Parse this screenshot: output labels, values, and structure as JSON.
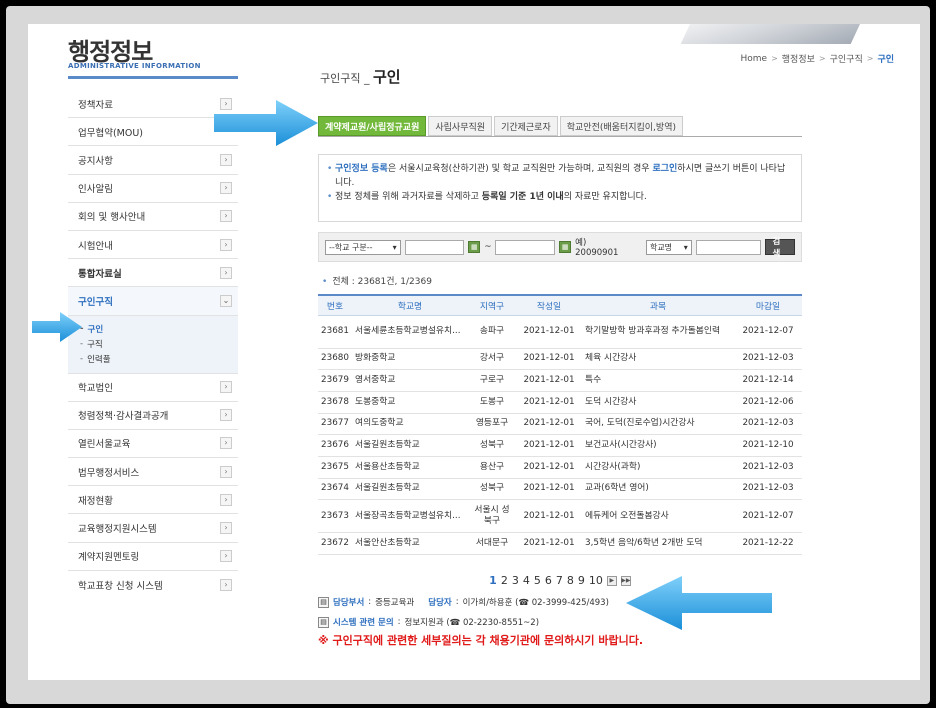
{
  "header": {
    "title": "행정정보",
    "subtitle": "ADMINISTRATIVE INFORMATION",
    "breadcrumb": [
      "Home",
      "행정정보",
      "구인구직",
      "구인"
    ]
  },
  "sidebar": {
    "items": [
      {
        "label": "정책자료"
      },
      {
        "label": "업무협약(MOU)"
      },
      {
        "label": "공지사항"
      },
      {
        "label": "인사알림"
      },
      {
        "label": "회의 및 행사안내"
      },
      {
        "label": "시험안내"
      },
      {
        "label": "통합자료실"
      },
      {
        "label": "구인구직"
      }
    ],
    "sub_items": [
      {
        "label": "구인"
      },
      {
        "label": "구직"
      },
      {
        "label": "인력풀"
      }
    ],
    "items_after": [
      {
        "label": "학교법인"
      },
      {
        "label": "청렴정책·감사결과공개"
      },
      {
        "label": "열린서울교육"
      },
      {
        "label": "법무행정서비스"
      },
      {
        "label": "재정현황"
      },
      {
        "label": "교육행정지원시스템"
      },
      {
        "label": "계약지원멘토링"
      },
      {
        "label": "학교표창 신청 시스템"
      }
    ]
  },
  "main": {
    "title_prefix": "구인구직 _ ",
    "title": "구인",
    "tabs": [
      {
        "label": "계약제교원/사립정규교원"
      },
      {
        "label": "사립사무직원"
      },
      {
        "label": "기간제근로자"
      },
      {
        "label": "학교안전(배움터지킴이,방역)"
      }
    ],
    "notice": {
      "line1_a": "구인정보 등록",
      "line1_b": "은 서울시교육청(산하기관) 및 학교 교직원만 가능하며, 교직원의 경우 ",
      "line1_c": "로그인",
      "line1_d": "하시면 글쓰기 버튼이 나타납니다.",
      "line2_a": "정보 정체를 위해 과거자료를 삭제하고 ",
      "line2_b": "등록일 기준 1년 이내",
      "line2_c": "의 자료만 유지합니다."
    },
    "search": {
      "school_select": "--학교 구분--",
      "tilde": "~",
      "example": "예) 20090901",
      "field_select": "학교명",
      "button": "검색"
    },
    "total": "전체 : 23681건, 1/2369",
    "columns": [
      "번호",
      "학교명",
      "지역구",
      "작성일",
      "과목",
      "마감일"
    ],
    "rows": [
      {
        "no": "23681",
        "school": "서울세륜초등학교병설유치...",
        "region": "송파구",
        "date": "2021-12-01",
        "subject": "학기말방학 방과후과정 추가돌봄인력",
        "deadline": "2021-12-07"
      },
      {
        "no": "23680",
        "school": "방화중학교",
        "region": "강서구",
        "date": "2021-12-01",
        "subject": "체육 시간강사",
        "deadline": "2021-12-03"
      },
      {
        "no": "23679",
        "school": "영서중학교",
        "region": "구로구",
        "date": "2021-12-01",
        "subject": "특수",
        "deadline": "2021-12-14"
      },
      {
        "no": "23678",
        "school": "도봉중학교",
        "region": "도봉구",
        "date": "2021-12-01",
        "subject": "도덕 시간강사",
        "deadline": "2021-12-06"
      },
      {
        "no": "23677",
        "school": "여의도중학교",
        "region": "영등포구",
        "date": "2021-12-01",
        "subject": "국어, 도덕(진로수업)시간강사",
        "deadline": "2021-12-03"
      },
      {
        "no": "23676",
        "school": "서울길원초등학교",
        "region": "성북구",
        "date": "2021-12-01",
        "subject": "보건교사(시간강사)",
        "deadline": "2021-12-10"
      },
      {
        "no": "23675",
        "school": "서울용산초등학교",
        "region": "용산구",
        "date": "2021-12-01",
        "subject": "시간강사(과학)",
        "deadline": "2021-12-03"
      },
      {
        "no": "23674",
        "school": "서울길원초등학교",
        "region": "성북구",
        "date": "2021-12-01",
        "subject": "교과(6학년 영어)",
        "deadline": "2021-12-03"
      },
      {
        "no": "23673",
        "school": "서울장곡초등학교병설유치...",
        "region": "서울시 성북구",
        "date": "2021-12-01",
        "subject": "에듀케어 오전돌봄강사",
        "deadline": "2021-12-07"
      },
      {
        "no": "23672",
        "school": "서울안산초등학교",
        "region": "서대문구",
        "date": "2021-12-01",
        "subject": "3,5학년 음악/6학년 2개반 도덕",
        "deadline": "2021-12-22"
      }
    ],
    "pages": [
      "1",
      "2",
      "3",
      "4",
      "5",
      "6",
      "7",
      "8",
      "9",
      "10"
    ],
    "contact1": {
      "label_dept": "담당부서",
      "dept": "중등교육과",
      "label_person": "담당자",
      "person": "이가희/하용훈 (☎ 02-3999-425/493)"
    },
    "contact2": {
      "label": "시스템 관련 문의",
      "value": "정보지원과 (☎ 02-2230-8551~2)"
    },
    "warning": "※ 구인구직에 관련한 세부질의는 각 채용기관에 문의하시기 바랍니다."
  },
  "colors": {
    "accent": "#2e6fbf",
    "tab_active": "#72b83a",
    "arrow": "#3aa9ea",
    "warning": "#e01919"
  }
}
